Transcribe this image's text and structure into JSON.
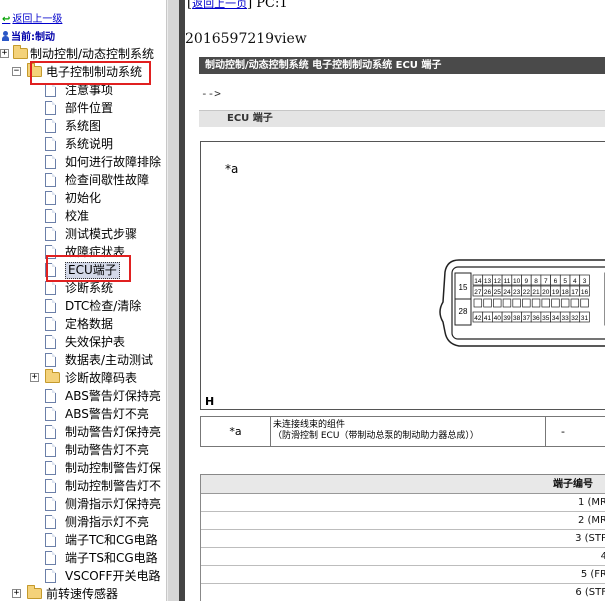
{
  "tree": {
    "back_link": "返回上一级",
    "current_label": "当前:制动",
    "items": [
      {
        "label": "制动控制/动态控制系统",
        "type": "folder"
      },
      {
        "label": "电子控制制动系统",
        "type": "folder-open"
      },
      {
        "label": "注意事项",
        "type": "doc"
      },
      {
        "label": "部件位置",
        "type": "doc"
      },
      {
        "label": "系统图",
        "type": "doc"
      },
      {
        "label": "系统说明",
        "type": "doc"
      },
      {
        "label": "如何进行故障排除",
        "type": "doc"
      },
      {
        "label": "检查间歇性故障",
        "type": "doc"
      },
      {
        "label": "初始化",
        "type": "doc"
      },
      {
        "label": "校准",
        "type": "doc"
      },
      {
        "label": "测试模式步骤",
        "type": "doc"
      },
      {
        "label": "故障症状表",
        "type": "doc"
      },
      {
        "label": "ECU端子",
        "type": "doc",
        "selected": true
      },
      {
        "label": "诊断系统",
        "type": "doc"
      },
      {
        "label": "DTC检查/清除",
        "type": "doc"
      },
      {
        "label": "定格数据",
        "type": "doc"
      },
      {
        "label": "失效保护表",
        "type": "doc"
      },
      {
        "label": "数据表/主动测试",
        "type": "doc"
      },
      {
        "label": "诊断故障码表",
        "type": "folder"
      },
      {
        "label": "ABS警告灯保持亮",
        "type": "doc"
      },
      {
        "label": "ABS警告灯不亮",
        "type": "doc"
      },
      {
        "label": "制动警告灯保持亮",
        "type": "doc"
      },
      {
        "label": "制动警告灯不亮",
        "type": "doc"
      },
      {
        "label": "制动控制警告灯保",
        "type": "doc"
      },
      {
        "label": "制动控制警告灯不",
        "type": "doc"
      },
      {
        "label": "侧滑指示灯保持亮",
        "type": "doc"
      },
      {
        "label": "侧滑指示灯不亮",
        "type": "doc"
      },
      {
        "label": "端子TC和CG电路",
        "type": "doc"
      },
      {
        "label": "端子TS和CG电路",
        "type": "doc"
      },
      {
        "label": "VSCOFF开关电路",
        "type": "doc"
      },
      {
        "label": "前转速传感器",
        "type": "folder"
      }
    ]
  },
  "content": {
    "back_link": "返回上一页",
    "pc_text": "PC:1",
    "view_text": "2016597219view",
    "title": "制动控制/动态控制系统  电子控制制动系统  ECU 端子",
    "arrow_text": "-->",
    "section_title": "ECU 端子",
    "diagram": {
      "a_label": "*a",
      "h_label": "H",
      "row1": [
        "14",
        "13",
        "12",
        "11",
        "10",
        "9",
        "8",
        "7",
        "6",
        "5",
        "4",
        "3"
      ],
      "row2": [
        "27",
        "26",
        "25",
        "24",
        "23",
        "22",
        "21",
        "20",
        "19",
        "18",
        "17",
        "16"
      ],
      "row3": [
        "42",
        "41",
        "40",
        "39",
        "38",
        "37",
        "36",
        "35",
        "34",
        "33",
        "32",
        "31"
      ],
      "left_top": "15",
      "left_bottom": "28",
      "right_top": "2",
      "right_bottom": "30"
    },
    "legend": {
      "key": "*a",
      "line1": "未连接线束的组件",
      "line2": "（防滑控制 ECU（带制动总泵的制动助力器总成））",
      "value": "-"
    },
    "terminal_table": {
      "header": "端子编号",
      "rows": [
        "1 (MR",
        "2 (MR",
        "3 (STP",
        "4",
        "5 (FR",
        "6 (STF"
      ]
    }
  }
}
